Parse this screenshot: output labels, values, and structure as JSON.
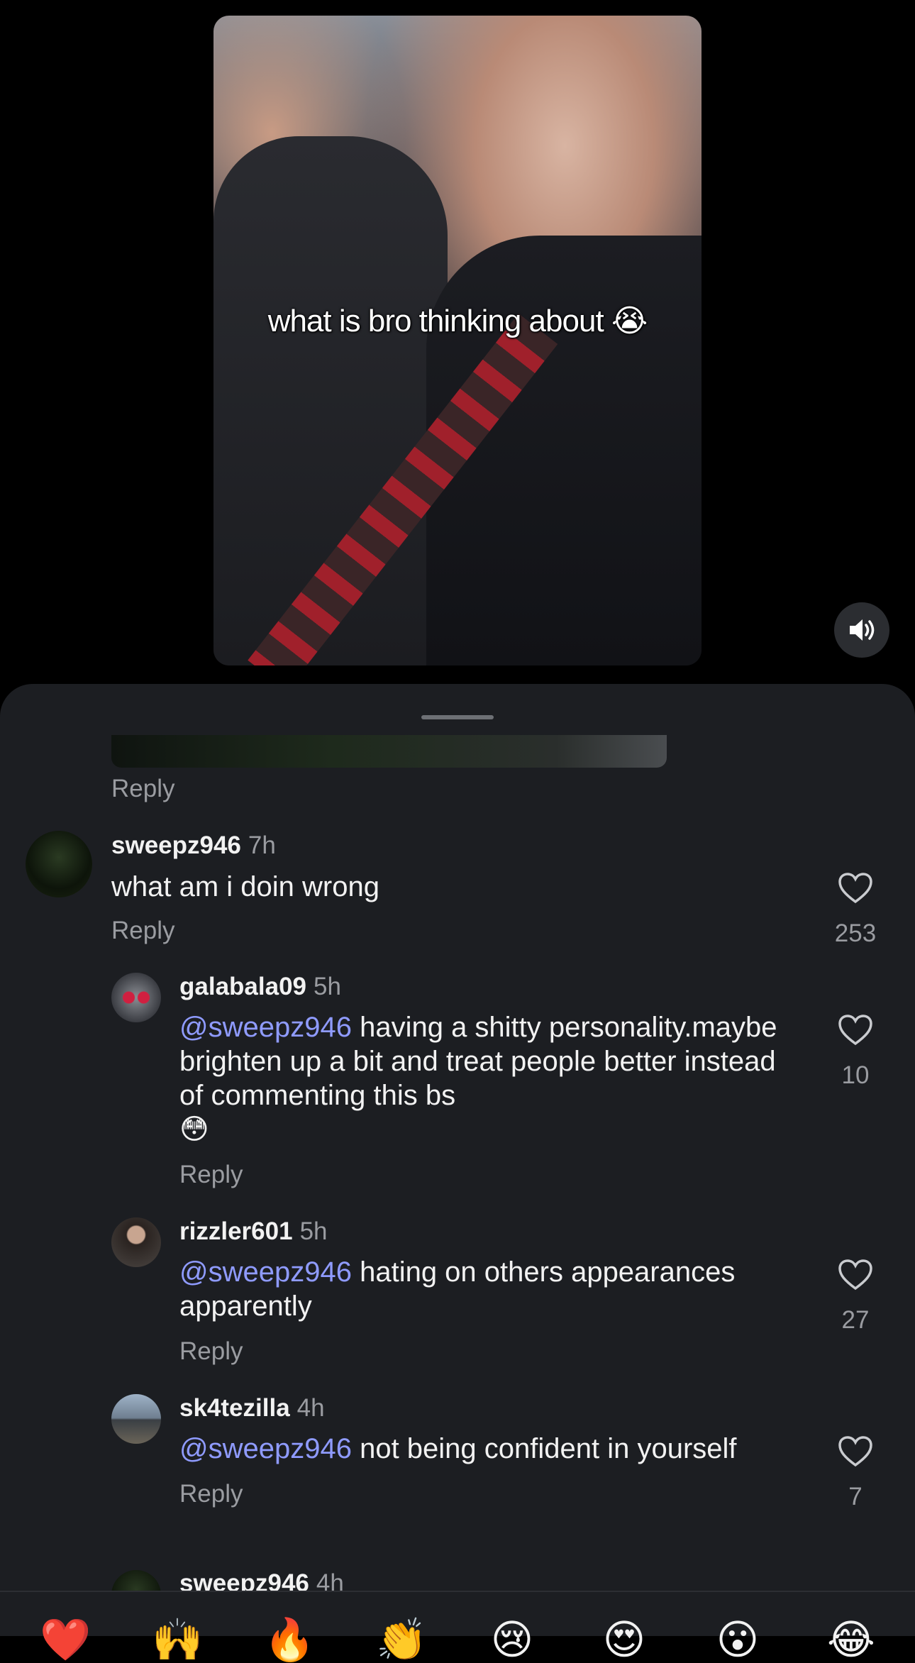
{
  "video": {
    "caption": "what is bro thinking about 😭",
    "sound_icon": "speaker-icon"
  },
  "comments": {
    "top_reply_label": "Reply",
    "main": {
      "username": "sweepz946",
      "time": "7h",
      "text": "what am i doin wrong",
      "reply_label": "Reply",
      "likes": "253"
    },
    "replies": [
      {
        "username": "galabala09",
        "time": "5h",
        "mention": "@sweepz946",
        "text": " having a shitty personality.maybe brighten up a bit and treat people better instead of commenting this bs",
        "emoji": "😳",
        "reply_label": "Reply",
        "likes": "10"
      },
      {
        "username": "rizzler601",
        "time": "5h",
        "mention": "@sweepz946",
        "text": " hating on others appearances apparently",
        "reply_label": "Reply",
        "likes": "27"
      },
      {
        "username": "sk4tezilla",
        "time": "4h",
        "mention": "@sweepz946",
        "text": " not being confident in yourself",
        "reply_label": "Reply",
        "likes": "7"
      }
    ],
    "partial": {
      "username": "sweepz946",
      "time": "4h"
    }
  },
  "reactions": [
    "❤️",
    "🙌",
    "🔥",
    "👏",
    "😢",
    "😍",
    "😮",
    "😂"
  ],
  "colors": {
    "sheet_bg": "#1c1e22",
    "mention": "#8f9bff",
    "muted_text": "#9a9ca1"
  }
}
